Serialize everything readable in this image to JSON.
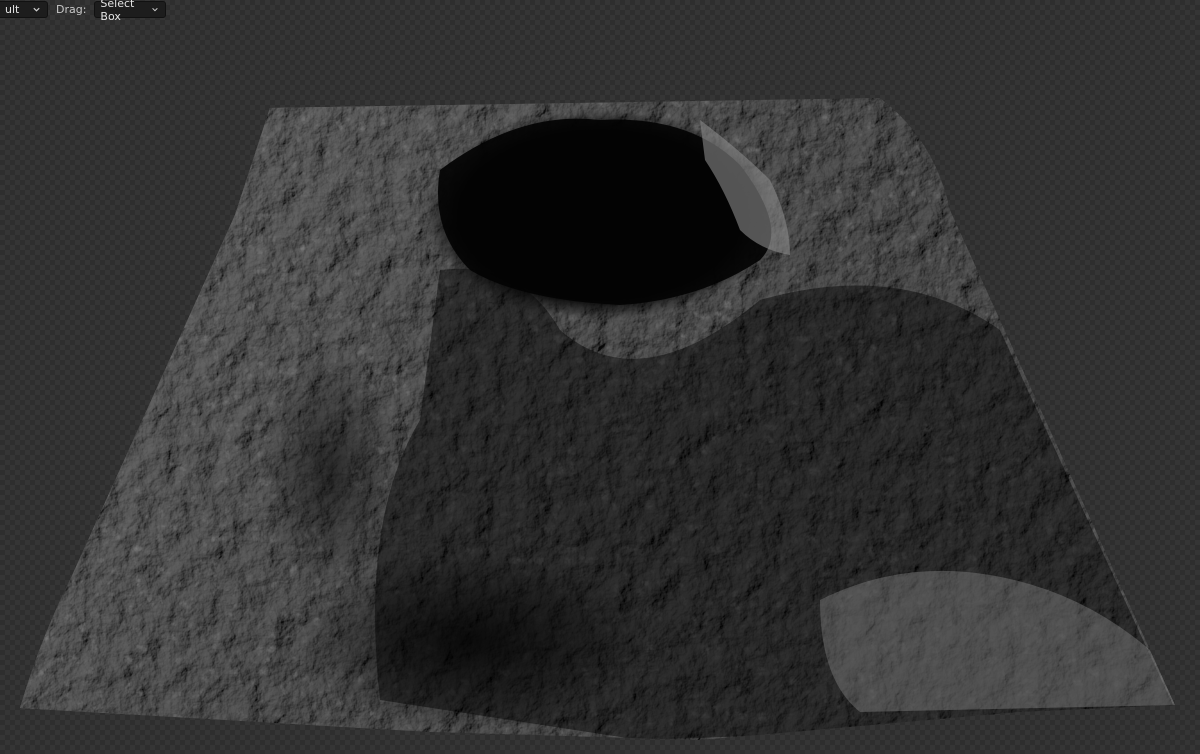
{
  "header": {
    "mode_value": "ult",
    "drag_label": "Drag:",
    "drag_value": "Select Box",
    "chevron_icon": "chevron-down-icon"
  },
  "viewport": {
    "subject": "rendered cratered terrain mesh",
    "background": "checkerboard-transparent",
    "colors": {
      "checker_dark": "#2e2e2e",
      "checker_light": "#353535",
      "surface_light": "#9a9a9a",
      "surface_dark": "#0a0a0a"
    }
  }
}
